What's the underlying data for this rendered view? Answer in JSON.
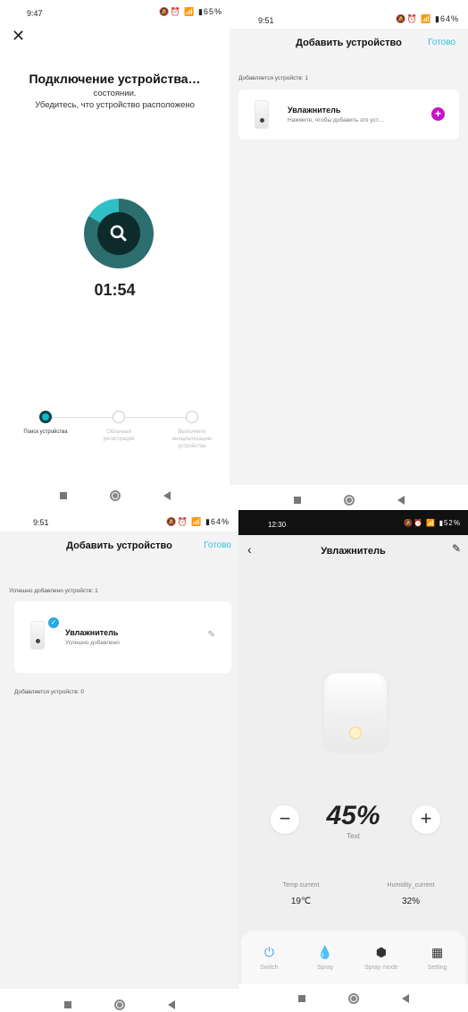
{
  "panel1": {
    "status_time": "9:47",
    "status_icons": "🔕⏰ 📶 ▮65%",
    "title": "Подключение устройства…",
    "subtitle_line1": "состоянии.",
    "subtitle_line2": "Убедитесь, что устройство расположено",
    "timer": "01:54",
    "steps": [
      {
        "label": "Поиск устройства",
        "active": true
      },
      {
        "label": "Облачная регистрация",
        "active": false
      },
      {
        "label": "Выполните инициализацию устройства",
        "active": false
      }
    ]
  },
  "panel2": {
    "status_time": "9:51",
    "status_icons": "🔕⏰ 📶 ▮64%",
    "header_title": "Добавить устройство",
    "done": "Готово",
    "adding_label": "Добавляется устройств: 1",
    "device_name": "Увлажнитель",
    "device_hint": "Нажмите, чтобы добавить это уст…"
  },
  "panel3": {
    "status_time": "9:51",
    "status_icons": "🔕⏰ 📶 ▮64%",
    "header_title": "Добавить устройство",
    "done": "Готово",
    "success_label": "Успешно добавлено устройств: 1",
    "device_name": "Увлажнитель",
    "device_hint": "Успешно добавлено",
    "adding_label": "Добавляется устройств: 0"
  },
  "panel4": {
    "status_time": "12:30",
    "status_icons": "🔕⏰ 📶 ▮52%",
    "title": "Увлажнитель",
    "humidity_value": "45%",
    "value_caption": "Text",
    "temp_label": "Temp current",
    "temp_value": "19℃",
    "hum_label": "Humidity_current",
    "hum_value": "32%",
    "tabs": [
      {
        "icon": "power-icon",
        "label": "Switch",
        "active": true
      },
      {
        "icon": "spray-icon",
        "label": "Spray",
        "active": false
      },
      {
        "icon": "spray-mode-icon",
        "label": "Spray mode",
        "active": false
      },
      {
        "icon": "setting-icon",
        "label": "Setting",
        "active": false
      }
    ]
  }
}
